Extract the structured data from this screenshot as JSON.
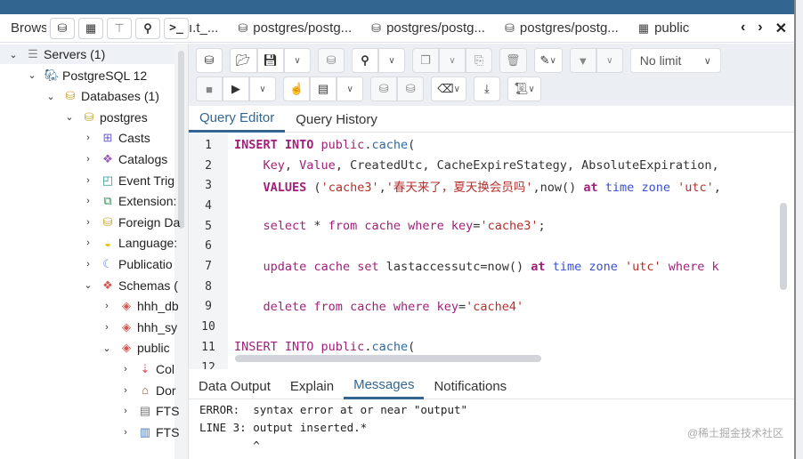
{
  "browser": {
    "label": "Browser",
    "buttons": [
      {
        "name": "query-tool",
        "icon": "database-icon"
      },
      {
        "name": "view-data",
        "icon": "table-icon"
      },
      {
        "name": "filtered-rows",
        "icon": "filter-table-icon"
      },
      {
        "name": "search-objects",
        "icon": "search-icon"
      },
      {
        "name": "psql-tool",
        "icon": "terminal-icon"
      }
    ]
  },
  "tabs": [
    {
      "label": "ı.t_...",
      "icon": ""
    },
    {
      "label": "postgres/postg...",
      "icon": "database-icon"
    },
    {
      "label": "postgres/postg...",
      "icon": "database-icon"
    },
    {
      "label": "postgres/postg...",
      "icon": "database-icon"
    },
    {
      "label": "public",
      "icon": "table-icon"
    }
  ],
  "tab_nav": {
    "prev": "‹",
    "next": "›",
    "close": "✕"
  },
  "tree": [
    {
      "label": "Servers (1)",
      "level": 0,
      "expanded": true,
      "icon": "servers-icon"
    },
    {
      "label": "PostgreSQL 12",
      "level": 1,
      "expanded": true,
      "icon": "elephant-icon"
    },
    {
      "label": "Databases (1)",
      "level": 2,
      "expanded": true,
      "icon": "databases-icon"
    },
    {
      "label": "postgres",
      "level": 3,
      "expanded": true,
      "icon": "database-icon"
    },
    {
      "label": "Casts",
      "level": 4,
      "expanded": false,
      "icon": "casts-icon"
    },
    {
      "label": "Catalogs",
      "level": 4,
      "expanded": false,
      "icon": "catalogs-icon"
    },
    {
      "label": "Event Trig",
      "level": 4,
      "expanded": false,
      "icon": "event-trigger-icon"
    },
    {
      "label": "Extension:",
      "level": 4,
      "expanded": false,
      "icon": "extension-icon"
    },
    {
      "label": "Foreign Da",
      "level": 4,
      "expanded": false,
      "icon": "foreign-data-icon"
    },
    {
      "label": "Language:",
      "level": 4,
      "expanded": false,
      "icon": "language-icon"
    },
    {
      "label": "Publicatio",
      "level": 4,
      "expanded": false,
      "icon": "publication-icon"
    },
    {
      "label": "Schemas (",
      "level": 4,
      "expanded": true,
      "icon": "schemas-icon"
    },
    {
      "label": "hhh_db",
      "level": 5,
      "expanded": false,
      "icon": "schema-icon"
    },
    {
      "label": "hhh_sy",
      "level": 5,
      "expanded": false,
      "icon": "schema-icon"
    },
    {
      "label": "public",
      "level": 5,
      "expanded": true,
      "icon": "schema-icon"
    },
    {
      "label": "Col",
      "level": 6,
      "expanded": false,
      "icon": "collation-icon"
    },
    {
      "label": "Dor",
      "level": 6,
      "expanded": false,
      "icon": "domain-icon"
    },
    {
      "label": "FTS",
      "level": 6,
      "expanded": false,
      "icon": "fts-config-icon"
    },
    {
      "label": "FTS",
      "level": 6,
      "expanded": false,
      "icon": "fts-dictionary-icon"
    }
  ],
  "toolbar": {
    "limit_label": "No limit",
    "chevron": "⌄"
  },
  "query_tabs": [
    {
      "label": "Query Editor",
      "active": true
    },
    {
      "label": "Query History",
      "active": false
    }
  ],
  "editor": {
    "lines": [
      {
        "n": "1",
        "tokens": [
          [
            "kw",
            "INSERT INTO "
          ],
          [
            "kw2",
            "public"
          ],
          [
            "txt",
            "."
          ],
          [
            "fn",
            "cache"
          ],
          [
            "txt",
            "("
          ]
        ]
      },
      {
        "n": "2",
        "tokens": [
          [
            "txt",
            "    "
          ],
          [
            "kw2",
            "Key"
          ],
          [
            "txt",
            ", "
          ],
          [
            "kw2",
            "Value"
          ],
          [
            "txt",
            ", CreatedUtc, CacheExpireStategy, AbsoluteExpiration,"
          ]
        ]
      },
      {
        "n": "3",
        "tokens": [
          [
            "txt",
            "    "
          ],
          [
            "kw",
            "VALUES"
          ],
          [
            "txt",
            " ("
          ],
          [
            "str",
            "'cache3'"
          ],
          [
            "txt",
            ","
          ],
          [
            "str",
            "'春天来了，夏天换会员吗'"
          ],
          [
            "txt",
            ",now() "
          ],
          [
            "kw",
            "at"
          ],
          [
            "tp",
            " time zone "
          ],
          [
            "str",
            "'utc'"
          ],
          [
            "txt",
            ","
          ]
        ]
      },
      {
        "n": "4",
        "tokens": []
      },
      {
        "n": "5",
        "tokens": [
          [
            "txt",
            "    "
          ],
          [
            "kw2",
            "select"
          ],
          [
            "txt",
            " * "
          ],
          [
            "kw2",
            "from"
          ],
          [
            "txt",
            " "
          ],
          [
            "kw2",
            "cache"
          ],
          [
            "txt",
            " "
          ],
          [
            "kw2",
            "where"
          ],
          [
            "txt",
            " "
          ],
          [
            "kw2",
            "key"
          ],
          [
            "txt",
            "="
          ],
          [
            "str",
            "'cache3'"
          ],
          [
            "txt",
            ";"
          ]
        ]
      },
      {
        "n": "6",
        "tokens": []
      },
      {
        "n": "7",
        "tokens": [
          [
            "txt",
            "    "
          ],
          [
            "kw2",
            "update"
          ],
          [
            "txt",
            " "
          ],
          [
            "kw2",
            "cache"
          ],
          [
            "txt",
            " "
          ],
          [
            "kw2",
            "set"
          ],
          [
            "txt",
            " lastaccessutc=now() "
          ],
          [
            "kw",
            "at"
          ],
          [
            "tp",
            " time zone "
          ],
          [
            "str",
            "'utc'"
          ],
          [
            "txt",
            " "
          ],
          [
            "kw2",
            "where k"
          ]
        ]
      },
      {
        "n": "8",
        "tokens": []
      },
      {
        "n": "9",
        "tokens": [
          [
            "txt",
            "    "
          ],
          [
            "kw2",
            "delete from"
          ],
          [
            "txt",
            " "
          ],
          [
            "kw2",
            "cache"
          ],
          [
            "txt",
            " "
          ],
          [
            "kw2",
            "where"
          ],
          [
            "txt",
            " "
          ],
          [
            "kw2",
            "key"
          ],
          [
            "txt",
            "="
          ],
          [
            "str",
            "'cache4'"
          ]
        ]
      },
      {
        "n": "10",
        "tokens": []
      },
      {
        "n": "11",
        "tokens": [
          [
            "kw2",
            "INSERT INTO public"
          ],
          [
            "txt",
            "."
          ],
          [
            "fn",
            "cache"
          ],
          [
            "txt",
            "("
          ]
        ]
      },
      {
        "n": "12",
        "tokens": []
      }
    ]
  },
  "output_tabs": [
    {
      "label": "Data Output",
      "active": false
    },
    {
      "label": "Explain",
      "active": false
    },
    {
      "label": "Messages",
      "active": true
    },
    {
      "label": "Notifications",
      "active": false
    }
  ],
  "messages": [
    "ERROR:  syntax error at or near \"output\"",
    "LINE 3: output inserted.*",
    "        ^"
  ],
  "watermark": "@稀土掘金技术社区"
}
